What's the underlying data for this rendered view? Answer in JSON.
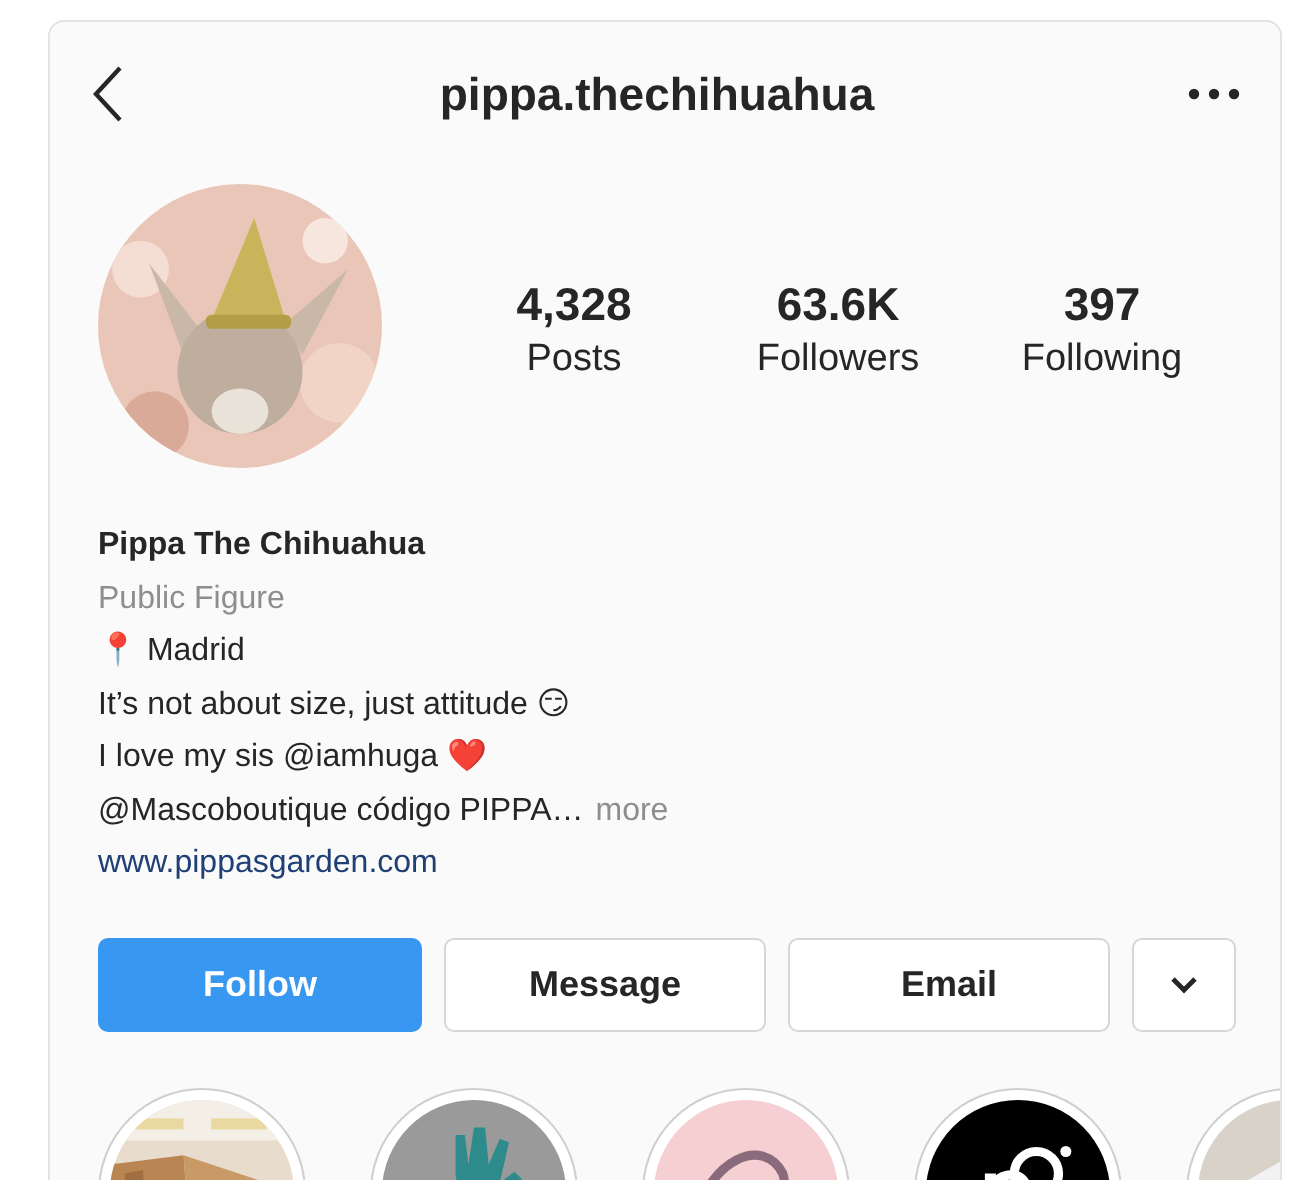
{
  "header": {
    "username": "pippa.thechihuahua"
  },
  "stats": [
    {
      "value": "4,328",
      "label": "Posts"
    },
    {
      "value": "63.6K",
      "label": "Followers"
    },
    {
      "value": "397",
      "label": "Following"
    }
  ],
  "bio": {
    "name": "Pippa The Chihuahua",
    "category": "Public Figure",
    "lines": [
      "📍 Madrid",
      "It’s not about size, just attitude 😏",
      "I love my sis @iamhuga ❤️",
      "@Mascoboutique código PIPPA…"
    ],
    "more": "more",
    "link": "www.pippasgarden.com"
  },
  "actions": [
    {
      "label": "Follow",
      "kind": "primary"
    },
    {
      "label": "Message",
      "kind": "secondary"
    },
    {
      "label": "Email",
      "kind": "secondary"
    },
    {
      "kind": "menu"
    }
  ]
}
